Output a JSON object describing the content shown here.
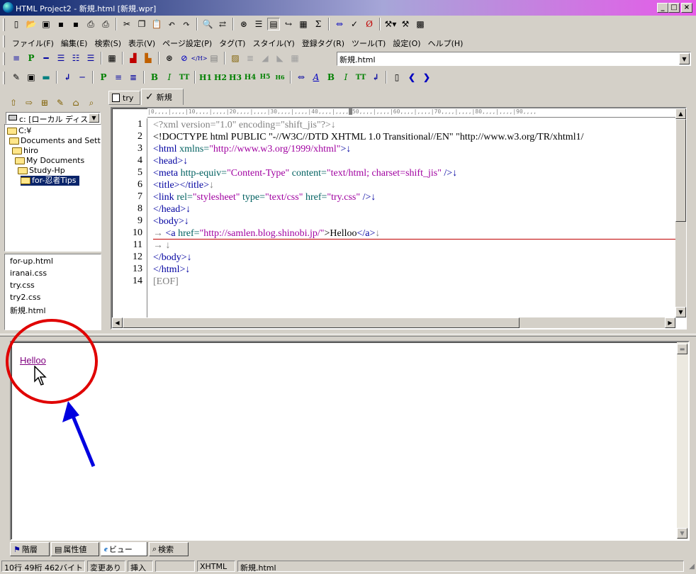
{
  "window": {
    "title": "HTML Project2 - 新規.html [新規.wpr]"
  },
  "menu": [
    "ファイル(F)",
    "編集(E)",
    "検索(S)",
    "表示(V)",
    "ページ設定(P)",
    "タグ(T)",
    "スタイル(Y)",
    "登録タグ(R)",
    "ツール(T)",
    "設定(O)",
    "ヘルプ(H)"
  ],
  "toolbar_combo": {
    "value": "新規.html"
  },
  "toolbar3": {
    "p": "P",
    "b": "B",
    "i": "I",
    "tt": "TT",
    "h1": "H1",
    "h2": "H2",
    "h3": "H3",
    "h4": "H4",
    "h5": "H5",
    "h6": "H6",
    "p2": "P",
    "b2": "B",
    "i2": "I",
    "tt2": "TT"
  },
  "drive": {
    "value": "c: [ローカル ディス"
  },
  "tree": [
    "C:¥",
    "Documents and Setti",
    "hiro",
    "My Documents",
    "Study-Hp",
    "for-忍者Tips"
  ],
  "files": [
    "for-up.html",
    "iranai.css",
    "try.css",
    "try2.css",
    "新規.html"
  ],
  "tabs": [
    {
      "label": "try"
    },
    {
      "label": "新規"
    }
  ],
  "ruler": "|0,,,,|,,,,|10,,,,|,,,,|20,,,,|,,,,|30,,,,|,,,,|40,,,,|,,,,█50,,,,|,,,,|60,,,,|,,,,|70,,,,|,,,,|80,,,,|,,,,|90,,,,",
  "code": {
    "line_numbers": [
      "1",
      "2",
      "3",
      "4",
      "5",
      "6",
      "7",
      "8",
      "9",
      "10",
      "11",
      "12",
      "13",
      "14"
    ],
    "l1": "<?xml version=\"1.0\" encoding=\"shift_jis\"?>↓",
    "l2": "<!DOCTYPE html PUBLIC \"-//W3C//DTD XHTML 1.0 Transitional//EN\" \"http://www.w3.org/TR/xhtml1/",
    "l3a": "<html",
    "l3b": " xmlns=",
    "l3c": "\"http://www.w3.org/1999/xhtml\"",
    "l3d": ">↓",
    "l4": "<head>↓",
    "l5a": "<meta",
    "l5b": " http-equiv=",
    "l5c": "\"Content-Type\"",
    "l5d": " content=",
    "l5e": "\"text/html; charset=shift_jis\"",
    "l5f": " />↓",
    "l6a": "<title></title>",
    "l6b": "↓",
    "l7a": "<link",
    "l7b": " rel=",
    "l7c": "\"stylesheet\"",
    "l7d": " type=",
    "l7e": "\"text/css\"",
    "l7f": " href=",
    "l7g": "\"try.css\"",
    "l7h": " />↓",
    "l8": "</head>↓",
    "l9": "<body>↓",
    "l10a": "→ ",
    "l10b": "<a",
    "l10c": " href=",
    "l10d": "\"http://samlen.blog.shinobi.jp/\"",
    "l10e": ">Helloo",
    "l10f": "</a>",
    "l10g": "↓",
    "l11": "→ ↓",
    "l12": "</body>↓",
    "l13": "</html>↓",
    "l14": "[EOF]"
  },
  "preview": {
    "link_text": "Helloo"
  },
  "bottom_tabs": [
    {
      "label": "階層"
    },
    {
      "label": "属性値"
    },
    {
      "label": "ビュー"
    },
    {
      "label": "検索"
    }
  ],
  "status": {
    "position": "10行 49桁 462バイト",
    "modified": "変更あり",
    "mode": "挿入",
    "type": "XHTML",
    "file": "新規.html"
  },
  "colors": {
    "title_start": "#0a246a",
    "title_end": "#e65ae8",
    "annotation": "#e00000",
    "arrow": "#0000e0"
  }
}
